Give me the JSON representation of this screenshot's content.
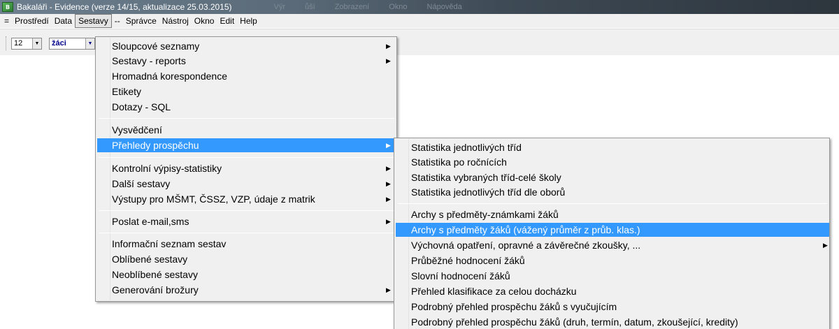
{
  "window": {
    "title": "Bakaláři - Evidence  (verze 14/15, aktualizace 25.03.2015)",
    "app_icon_text": "B",
    "extra_titles": [
      "Výr",
      "ůší",
      "Zobrazení",
      "Okno",
      "Nápověda"
    ]
  },
  "menubar": {
    "system_label": "=",
    "items": [
      "Prostředí",
      "Data",
      "Sestavy",
      "--",
      "Správce",
      "Nástroj",
      "Okno",
      "Edit",
      "Help"
    ]
  },
  "toolbar": {
    "font_size": "12",
    "group": "žáci",
    "dropdown_arrow": "▼"
  },
  "main_menu": {
    "items": [
      {
        "label": "Sloupcové seznamy",
        "submenu": true
      },
      {
        "label": "Sestavy - reports",
        "submenu": true
      },
      {
        "label": "Hromadná korespondence",
        "submenu": false
      },
      {
        "label": "Etikety",
        "submenu": false
      },
      {
        "label": "Dotazy - SQL",
        "submenu": false
      },
      {
        "label": "Vysvědčení",
        "submenu": false
      },
      {
        "label": "Přehledy prospěchu",
        "submenu": true,
        "highlighted": true
      },
      {
        "label": "Kontrolní výpisy-statistiky",
        "submenu": true
      },
      {
        "label": "Další sestavy",
        "submenu": true
      },
      {
        "label": "Výstupy pro MŠMT, ČSSZ, VZP, údaje z matrik",
        "submenu": true
      },
      {
        "label": "Poslat e-mail,sms",
        "submenu": true
      },
      {
        "label": "Informační seznam sestav",
        "submenu": false
      },
      {
        "label": "Oblíbené sestavy",
        "submenu": false
      },
      {
        "label": "Neoblíbené sestavy",
        "submenu": false
      },
      {
        "label": "Generování brožury",
        "submenu": true
      }
    ]
  },
  "sub_menu": {
    "items": [
      {
        "label": "Statistika jednotlivých tříd",
        "submenu": false
      },
      {
        "label": "Statistika po ročnících",
        "submenu": false
      },
      {
        "label": "Statistika vybraných tříd-celé školy",
        "submenu": false
      },
      {
        "label": "Statistika jednotlivých tříd dle oborů",
        "submenu": false
      },
      {
        "label": "Archy s předměty-známkami žáků",
        "submenu": false
      },
      {
        "label": "Archy s předměty žáků (vážený průměr z průb. klas.)",
        "submenu": false,
        "highlighted": true
      },
      {
        "label": "Výchovná opatření, opravné a závěrečné zkoušky, ...",
        "submenu": true
      },
      {
        "label": "Průběžné hodnocení žáků",
        "submenu": false
      },
      {
        "label": "Slovní hodnocení žáků",
        "submenu": false
      },
      {
        "label": "Přehled klasifikace za celou docházku",
        "submenu": false
      },
      {
        "label": "Podrobný přehled prospěchu žáků s vyučujícím",
        "submenu": false
      },
      {
        "label": "Podrobný přehled prospěchu žáků (druh, termín, datum, zkoušející, kredity)",
        "submenu": false
      }
    ]
  },
  "icons": {
    "submenu_arrow": "▶"
  },
  "colors": {
    "highlight": "#3399ff",
    "menu_background": "#f0f0f0"
  }
}
